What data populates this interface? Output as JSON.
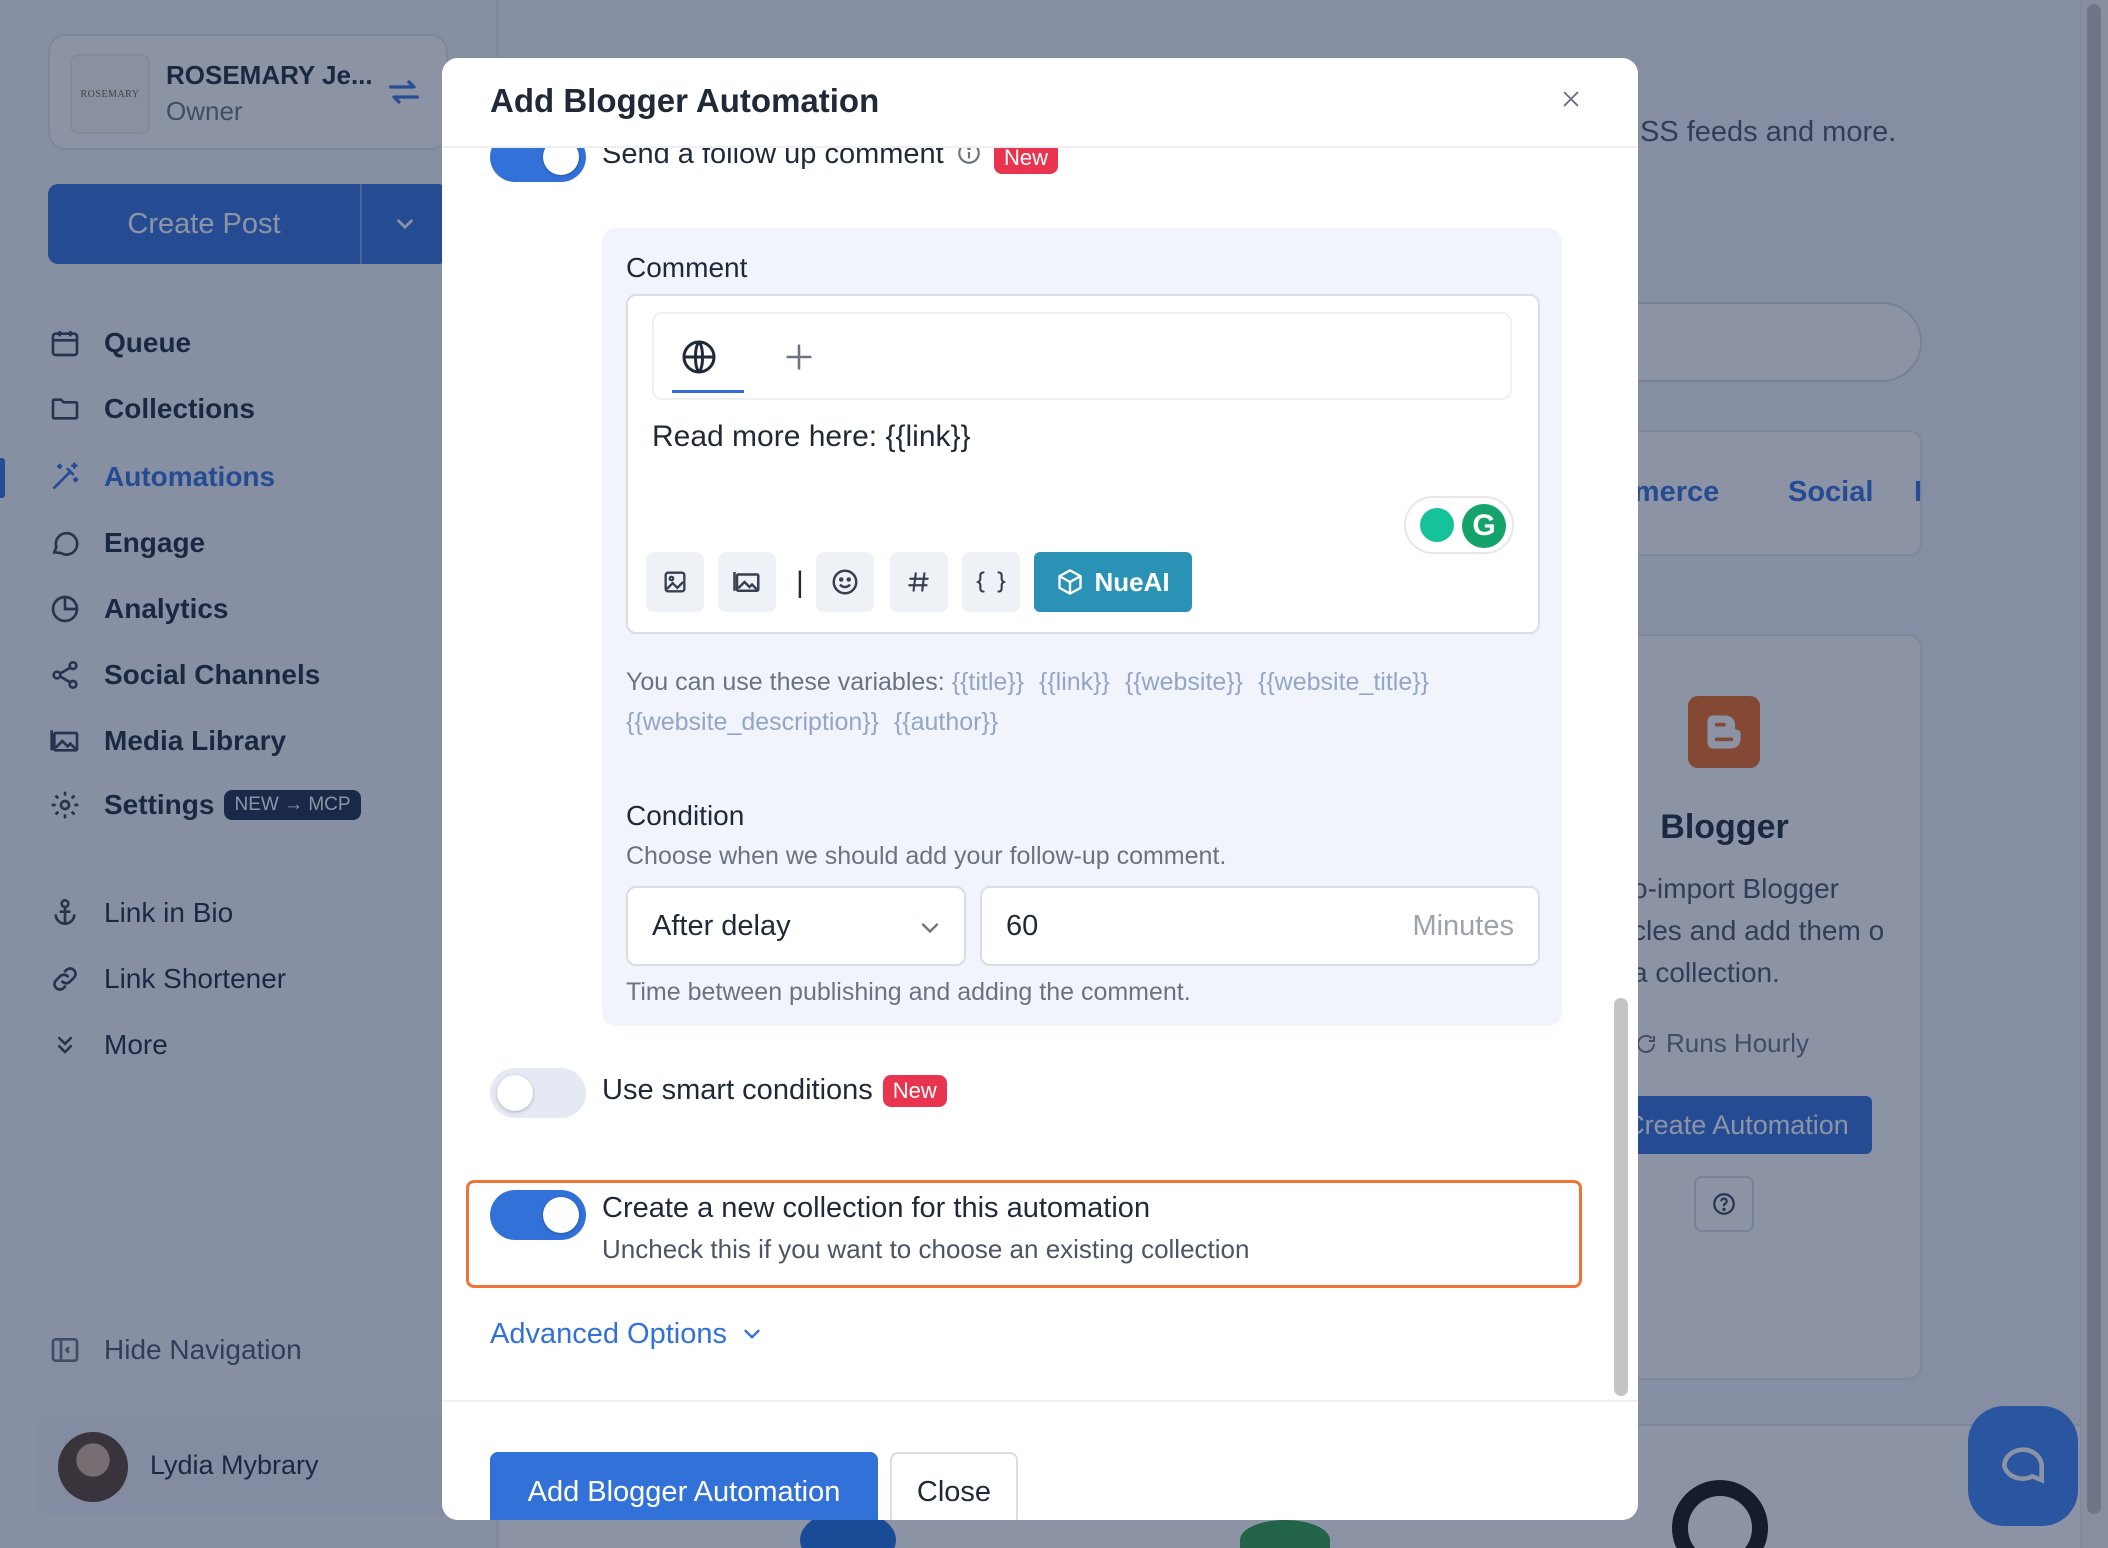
{
  "sidebar": {
    "account": {
      "logo_text": "ROSEMARY",
      "name": "ROSEMARY Je...",
      "role": "Owner"
    },
    "create_post_label": "Create Post",
    "nav": [
      {
        "label": "Queue",
        "icon": "calendar-icon"
      },
      {
        "label": "Collections",
        "icon": "folder-icon"
      },
      {
        "label": "Automations",
        "icon": "magic-wand-icon",
        "active": true
      },
      {
        "label": "Engage",
        "icon": "chat-bubble-icon"
      },
      {
        "label": "Analytics",
        "icon": "pie-chart-icon"
      },
      {
        "label": "Social Channels",
        "icon": "share-icon"
      },
      {
        "label": "Media Library",
        "icon": "images-icon"
      },
      {
        "label": "Settings",
        "icon": "gear-icon",
        "badge": "NEW → MCP"
      }
    ],
    "nav_secondary": [
      {
        "label": "Link in Bio",
        "icon": "anchor-icon"
      },
      {
        "label": "Link Shortener",
        "icon": "link-icon"
      },
      {
        "label": "More",
        "icon": "chevrons-down-icon"
      }
    ],
    "hide_navigation_label": "Hide Navigation",
    "user_name": "Lydia Mybrary"
  },
  "background": {
    "description_fragment": "SS feeds and more.",
    "tabs": [
      "mmerce",
      "Social",
      "I"
    ],
    "card": {
      "title": "Blogger",
      "description": "o-import Blogger cles and add them o a collection.",
      "schedule": "Runs Hourly",
      "button_label": "Create Automation"
    }
  },
  "modal": {
    "title": "Add Blogger Automation",
    "followup": {
      "label": "Send a follow up comment",
      "badge": "New",
      "enabled": true
    },
    "comment": {
      "label": "Comment",
      "text": "Read more here:  {{link}}",
      "ai_button_label": "NueAI",
      "variables_intro": "You can use these variables:",
      "variables": [
        "{{title}}",
        "{{link}}",
        "{{website}}",
        "{{website_title}}",
        "{{website_description}}",
        "{{author}}"
      ]
    },
    "condition": {
      "label": "Condition",
      "description": "Choose when we should add your follow-up comment.",
      "selected": "After delay",
      "delay_value": "60",
      "delay_unit": "Minutes",
      "hint": "Time between publishing and adding the comment."
    },
    "smart_conditions": {
      "label": "Use smart conditions",
      "badge": "New",
      "enabled": false
    },
    "new_collection": {
      "label": "Create a new collection for this automation",
      "description": "Uncheck this if you want to choose an existing collection",
      "enabled": true
    },
    "advanced_label": "Advanced Options",
    "footer": {
      "submit_label": "Add Blogger Automation",
      "close_label": "Close"
    }
  },
  "colors": {
    "accent": "#3271d8",
    "danger": "#e8344e",
    "highlight": "#f0743a",
    "nueai": "#2a93b5"
  }
}
